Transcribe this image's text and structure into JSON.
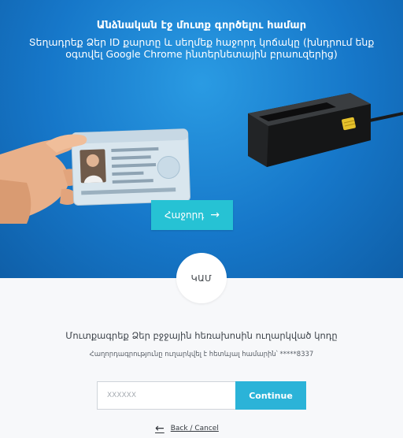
{
  "hero": {
    "title": "Անձնական էջ մուտք գործելու համար",
    "subtitle": "Տեղադրեք Ձեր ID քարտը և սեղմեք հաջորդ կոճակը (խնդրում ենք օգտվել Google Chrome ինտերնետային բրաուզերից)",
    "next_label": "Հաջորդ",
    "next_icon": "arrow-right-icon"
  },
  "divider": {
    "or_label": "ԿԱՄ"
  },
  "sms": {
    "title": "Մուտքագրեք Ձեր բջջային հեռախոսին ուղարկված կոդը",
    "note": "Հաղորդագրությունը ուղարկվել է հետևյալ համարին՝ *****8337",
    "input_placeholder": "XXXXXX",
    "continue_label": "Continue",
    "back_label": "Back / Cancel",
    "back_icon": "arrow-left-icon"
  },
  "colors": {
    "hero_blue": "#1677c9",
    "button_teal": "#26c2d4",
    "continue_blue": "#2bb3d8"
  }
}
